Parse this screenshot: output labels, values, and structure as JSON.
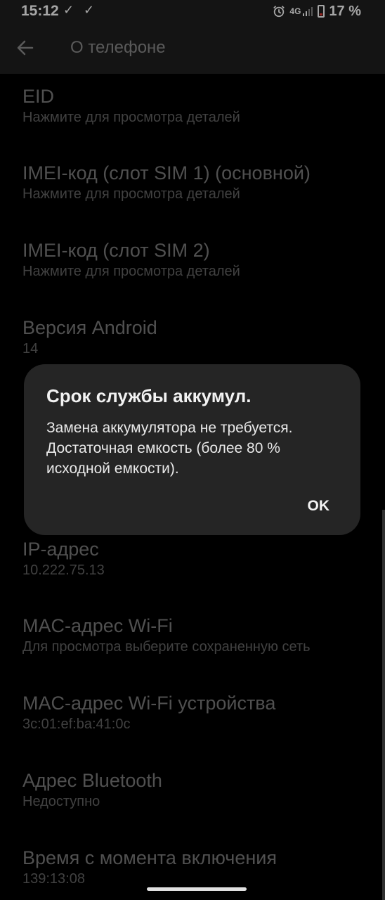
{
  "status_bar": {
    "time": "15:12",
    "check1": "✓",
    "check2": "✓",
    "network": "4G",
    "battery": "17 %"
  },
  "toolbar": {
    "title": "О телефоне"
  },
  "items": [
    {
      "title": "EID",
      "sub": "Нажмите для просмотра деталей"
    },
    {
      "title": "IMEI-код (слот SIM 1) (основной)",
      "sub": "Нажмите для просмотра деталей"
    },
    {
      "title": "IMEI-код (слот SIM 2)",
      "sub": "Нажмите для просмотра деталей"
    },
    {
      "title": "Версия Android",
      "sub": "14"
    },
    {
      "title": "IP-адрес",
      "sub": "10.222.75.13"
    },
    {
      "title": "MAC-адрес Wi-Fi",
      "sub": "Для просмотра выберите сохраненную сеть"
    },
    {
      "title": "MAC-адрес Wi-Fi устройства",
      "sub": "3c:01:ef:ba:41:0c"
    },
    {
      "title": "Адрес Bluetooth",
      "sub": "Недоступно"
    },
    {
      "title": "Время с момента включения",
      "sub": "139:13:08"
    }
  ],
  "dialog": {
    "title": "Срок службы аккумул.",
    "body": "Замена аккумулятора не требуется. Достаточная емкость (более 80 % исходной емкости).",
    "ok_label": "OK"
  },
  "colors": {
    "bar_bg": "#202020",
    "dialog_bg": "#252525",
    "battery_low": "#e53935"
  }
}
